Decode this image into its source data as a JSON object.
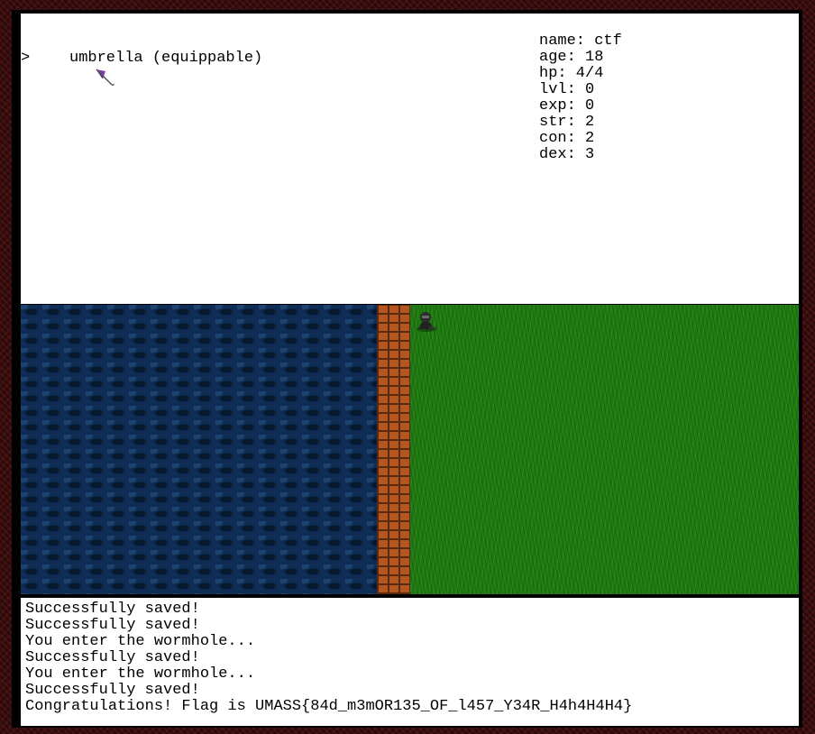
{
  "inventory": {
    "cursor": ">",
    "items": [
      {
        "label": "umbrella (equippable)",
        "icon": "umbrella-icon"
      }
    ]
  },
  "stats": [
    "name: ctf",
    "age: 18",
    "hp: 4/4",
    "lvl: 0",
    "exp: 0",
    "str: 2",
    "con: 2",
    "dex: 3"
  ],
  "map": {
    "tiles": [
      "water",
      "brick-wall",
      "grass"
    ],
    "player": "player-sprite"
  },
  "log": [
    "Successfully saved!",
    "Successfully saved!",
    "You enter the wormhole...",
    "Successfully saved!",
    "You enter the wormhole...",
    "Successfully saved!",
    "Congratulations! Flag is UMASS{84d_m3mOR135_OF_l457_Y34R_H4h4H4H4}"
  ],
  "colors": {
    "frame": "#000000",
    "water": "#0f2c55",
    "brick": "#b3561f",
    "grass": "#1f7a12",
    "umbrella": "#7b3fa6"
  }
}
